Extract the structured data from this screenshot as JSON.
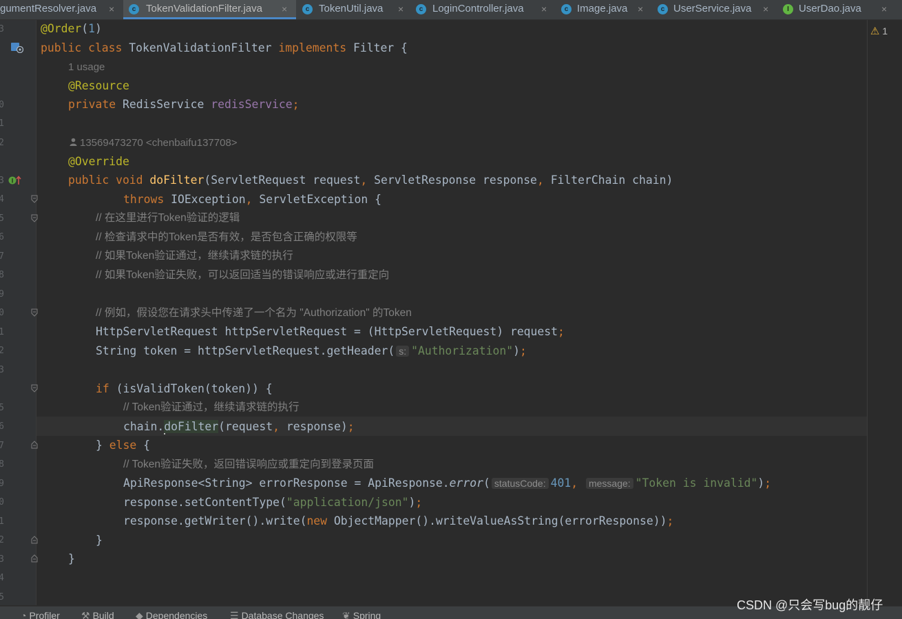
{
  "tabs": [
    {
      "label": "gumentResolver.java",
      "icon": "class-icon"
    },
    {
      "label": "TokenValidationFilter.java",
      "icon": "class-icon",
      "active": true
    },
    {
      "label": "TokenUtil.java",
      "icon": "class-icon"
    },
    {
      "label": "LoginController.java",
      "icon": "class-icon"
    },
    {
      "label": "Image.java",
      "icon": "class-icon"
    },
    {
      "label": "UserService.java",
      "icon": "class-icon"
    },
    {
      "label": "UserDao.java",
      "icon": "interface-icon"
    }
  ],
  "tab_close_glyph": "×",
  "file_icon_letters": {
    "class": "c",
    "interface": "I"
  },
  "inspections": {
    "count": "1"
  },
  "gutter": {
    "line_numbers": [
      "3",
      "",
      "",
      "0",
      "1",
      "2",
      "",
      "3",
      "4",
      "5",
      "6",
      "7",
      "8",
      "9",
      "0",
      "1",
      "2",
      "3",
      "",
      "5",
      "6",
      "7",
      "8",
      "9",
      "0",
      "1",
      "2",
      "3",
      "4",
      "5",
      ""
    ]
  },
  "code": {
    "l1": {
      "at": "@Order",
      "open": "(",
      "num": "1",
      "close": ")"
    },
    "l2": {
      "kw1": "public class ",
      "name": "TokenValidationFilter ",
      "kw2": "implements ",
      "iface": "Filter {"
    },
    "l3": {
      "usage": "1 usage"
    },
    "l4": {
      "ann": "@Resource"
    },
    "l5": {
      "kw": "private ",
      "type": "RedisService ",
      "field": "redisService",
      "semi": ";"
    },
    "l6": {
      "author": "13569473270 <chenbaifu137708>"
    },
    "l7": {
      "ann": "@Override"
    },
    "l8": {
      "kw": "public void ",
      "fn": "doFilter",
      "p1": "(ServletRequest request",
      "c1": ", ",
      "p2": "ServletResponse response",
      "c2": ", ",
      "p3": "FilterChain chain)"
    },
    "l9": {
      "kw": "throws ",
      "t1": "IOException",
      "c": ", ",
      "t2": "ServletException {"
    },
    "l10": "// 在这里进行Token验证的逻辑",
    "l11": "// 检查请求中的Token是否有效，是否包含正确的权限等",
    "l12": "// 如果Token验证通过，继续请求链的执行",
    "l13": "// 如果Token验证失败，可以返回适当的错误响应或进行重定向",
    "l14": "// 例如，假设您在请求头中传递了一个名为 \"Authorization\" 的Token",
    "l15": {
      "a": "HttpServletRequest httpServletRequest = (HttpServletRequest) request",
      "semi": ";"
    },
    "l16": {
      "a": "String token = httpServletRequest.getHeader(",
      "hint": "s:",
      "str": "\"Authorization\"",
      "b": ")",
      "semi": ";"
    },
    "l17": {
      "kw": "if ",
      "a": "(isValidToken(token)) {"
    },
    "l18": "// Token验证通过，继续请求链的执行",
    "l19": {
      "a": "chain.",
      "ref": "doFilter",
      "b": "(request",
      "c": ", ",
      "d": "response)",
      "semi": ";"
    },
    "l20": {
      "a": "} ",
      "kw": "else ",
      "b": "{"
    },
    "l21": "// Token验证失败，返回错误响应或重定向到登录页面",
    "l22": {
      "a": "ApiResponse<String> errorResponse = ApiResponse.",
      "m": "error",
      "b": "(",
      "h1": "statusCode:",
      "num": "401",
      "c": ", ",
      "h2": "message:",
      "str": "\"Token is invalid\"",
      "d": ")",
      "semi": ";"
    },
    "l23": {
      "a": "response.setContentType(",
      "str": "\"application/json\"",
      "b": ")",
      "semi": ";"
    },
    "l24": {
      "a": "response.getWriter().write(",
      "kw": "new ",
      "b": "ObjectMapper().writeValueAsString(errorResponse))",
      "semi": ";"
    },
    "l25": "}",
    "l26": "}"
  },
  "bottom_tools": [
    "Profiler",
    "Build",
    "Dependencies",
    "Database Changes",
    "Spring"
  ],
  "watermark": "CSDN @只会写bug的靓仔"
}
